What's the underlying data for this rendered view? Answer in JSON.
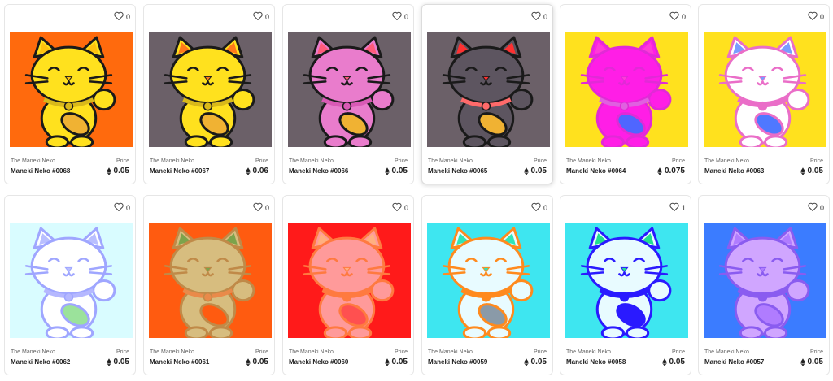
{
  "collection_label": "The Maneki Neko",
  "price_label": "Price",
  "cards": [
    {
      "name": "Maneki Neko #0068",
      "price": "0.05",
      "likes": "0",
      "colors": {
        "bg": "#ff6a0d",
        "body": "#ffe11e",
        "stroke": "#1a1a1a",
        "ear": "#ffc20e",
        "collar": "#d9b91a",
        "coin": "#f0b233"
      }
    },
    {
      "name": "Maneki Neko #0067",
      "price": "0.06",
      "likes": "0",
      "colors": {
        "bg": "#6b6068",
        "body": "#ffe11e",
        "stroke": "#1a1a1a",
        "ear": "#ff7a1a",
        "collar": "#d9b91a",
        "coin": "#f0b233"
      }
    },
    {
      "name": "Maneki Neko #0066",
      "price": "0.05",
      "likes": "0",
      "colors": {
        "bg": "#6b6068",
        "body": "#e97ccc",
        "stroke": "#1a1a1a",
        "ear": "#ff5b7a",
        "collar": "#d95ab5",
        "coin": "#f0b233"
      }
    },
    {
      "name": "Maneki Neko #0065",
      "price": "0.05",
      "likes": "0",
      "colors": {
        "bg": "#6b6068",
        "body": "#5d5560",
        "stroke": "#1a1a1a",
        "ear": "#ff3030",
        "collar": "#ff6a6a",
        "coin": "#f0b233"
      }
    },
    {
      "name": "Maneki Neko #0064",
      "price": "0.075",
      "likes": "0",
      "colors": {
        "bg": "#ffe11e",
        "body": "#ff1ee6",
        "stroke": "#e12ad6",
        "ear": "#ff3bd8",
        "collar": "#e060e0",
        "coin": "#4f66ff"
      }
    },
    {
      "name": "Maneki Neko #0063",
      "price": "0.05",
      "likes": "0",
      "colors": {
        "bg": "#ffe11e",
        "body": "#ffffff",
        "stroke": "#ea6ec8",
        "ear": "#7a9cff",
        "collar": "#ea6ec8",
        "coin": "#4f78ff"
      }
    },
    {
      "name": "Maneki Neko #0062",
      "price": "0.05",
      "likes": "0",
      "colors": {
        "bg": "#d9fcff",
        "body": "#ffffff",
        "stroke": "#9fa6ff",
        "ear": "#b9bfff",
        "collar": "#b5b8ff",
        "coin": "#9be29b"
      }
    },
    {
      "name": "Maneki Neko #0061",
      "price": "0.05",
      "likes": "0",
      "colors": {
        "bg": "#ff5b10",
        "body": "#d7bd7f",
        "stroke": "#c08a48",
        "ear": "#7ca34b",
        "collar": "#e98a4a",
        "coin": "#ff5b10"
      }
    },
    {
      "name": "Maneki Neko #0060",
      "price": "0.05",
      "likes": "0",
      "colors": {
        "bg": "#ff1a1a",
        "body": "#ff9a9a",
        "stroke": "#ff7a40",
        "ear": "#ffb080",
        "collar": "#ff7a40",
        "coin": "#ff5050"
      }
    },
    {
      "name": "Maneki Neko #0059",
      "price": "0.05",
      "likes": "0",
      "colors": {
        "bg": "#3ee6f0",
        "body": "#e8fbff",
        "stroke": "#ff8a1e",
        "ear": "#2ee6b8",
        "collar": "#ff8a1e",
        "coin": "#8a9aa8"
      }
    },
    {
      "name": "Maneki Neko #0058",
      "price": "0.05",
      "likes": "1",
      "colors": {
        "bg": "#3ee6f0",
        "body": "#e8fbff",
        "stroke": "#2a1aff",
        "ear": "#20e090",
        "collar": "#2a1aff",
        "coin": "#2a1aff"
      }
    },
    {
      "name": "Maneki Neko #0057",
      "price": "0.05",
      "likes": "0",
      "colors": {
        "bg": "#3b7cff",
        "body": "#d0a6ff",
        "stroke": "#8a5cf0",
        "ear": "#b07cff",
        "collar": "#8a5cf0",
        "coin": "#b07cff"
      }
    }
  ]
}
